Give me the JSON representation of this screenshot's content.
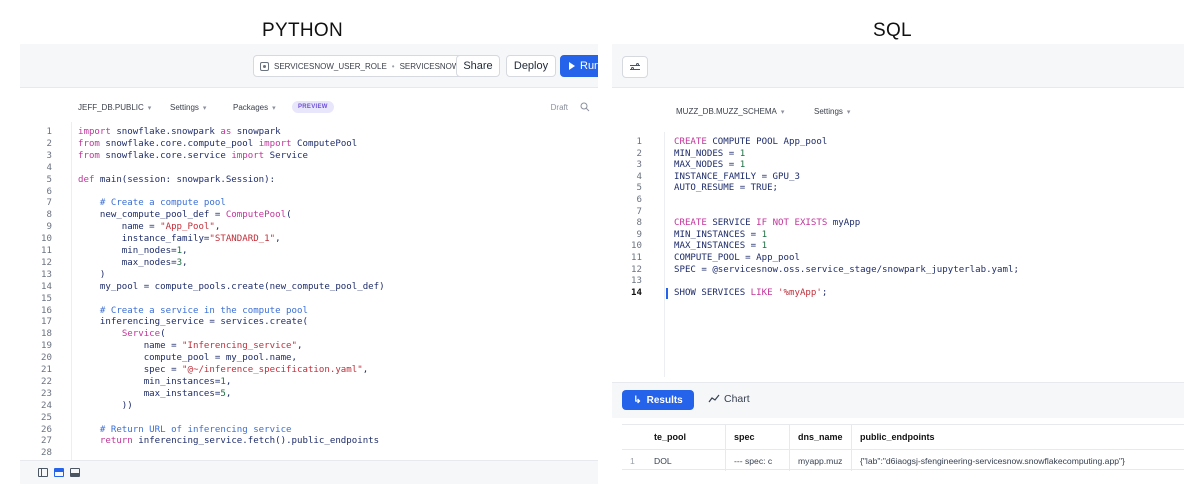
{
  "headings": {
    "python": "PYTHON",
    "sql": "SQL"
  },
  "python_panel": {
    "role_chip": {
      "role": "SERVICESNOW_USER_ROLE",
      "separator": "•",
      "warehouse": "SERVICESNOW"
    },
    "buttons": {
      "share": "Share",
      "deploy": "Deploy",
      "run": "Run"
    },
    "subbar": {
      "database": "JEFF_DB.PUBLIC",
      "settings": "Settings",
      "packages": "Packages",
      "badge": "PREVIEW",
      "status": "Draft"
    },
    "lines": [
      "1",
      "2",
      "3",
      "4",
      "5",
      "6",
      "7",
      "8",
      "9",
      "10",
      "11",
      "12",
      "13",
      "14",
      "15",
      "16",
      "17",
      "18",
      "19",
      "20",
      "21",
      "22",
      "23",
      "24",
      "25",
      "26",
      "27",
      "28"
    ],
    "code": [
      [
        [
          "kw",
          "import"
        ],
        [
          "p",
          " snowflake.snowpark "
        ],
        [
          "kw",
          "as"
        ],
        [
          "p",
          " snowpark"
        ]
      ],
      [
        [
          "kw",
          "from"
        ],
        [
          "p",
          " snowflake.core.compute_pool "
        ],
        [
          "kw",
          "import"
        ],
        [
          "p",
          " ComputePool"
        ]
      ],
      [
        [
          "kw",
          "from"
        ],
        [
          "p",
          " snowflake.core.service "
        ],
        [
          "kw",
          "import"
        ],
        [
          "p",
          " Service"
        ]
      ],
      [],
      [
        [
          "kw",
          "def"
        ],
        [
          "p",
          " main(session: snowpark.Session):"
        ]
      ],
      [],
      [
        [
          "p",
          "    "
        ],
        [
          "cmt",
          "# Create a compute pool"
        ]
      ],
      [
        [
          "p",
          "    new_compute_pool_def = "
        ],
        [
          "kw",
          "ComputePool"
        ],
        [
          "p",
          "("
        ]
      ],
      [
        [
          "p",
          "        name = "
        ],
        [
          "str",
          "\"App_Pool\""
        ],
        [
          "p",
          ","
        ]
      ],
      [
        [
          "p",
          "        instance_family="
        ],
        [
          "str",
          "\"STANDARD_1\""
        ],
        [
          "p",
          ","
        ]
      ],
      [
        [
          "p",
          "        min_nodes="
        ],
        [
          "num",
          "1"
        ],
        [
          "p",
          ","
        ]
      ],
      [
        [
          "p",
          "        max_nodes="
        ],
        [
          "num",
          "3"
        ],
        [
          "p",
          ","
        ]
      ],
      [
        [
          "p",
          "    )"
        ]
      ],
      [
        [
          "p",
          "    my_pool = compute_pools.create(new_compute_pool_def)"
        ]
      ],
      [],
      [
        [
          "p",
          "    "
        ],
        [
          "cmt",
          "# Create a service in the compute pool"
        ]
      ],
      [
        [
          "p",
          "    inferencing_service = services.create("
        ]
      ],
      [
        [
          "p",
          "        "
        ],
        [
          "kw",
          "Service"
        ],
        [
          "p",
          "("
        ]
      ],
      [
        [
          "p",
          "            name = "
        ],
        [
          "str",
          "\"Inferencing_service\""
        ],
        [
          "p",
          ","
        ]
      ],
      [
        [
          "p",
          "            compute_pool = my_pool.name,"
        ]
      ],
      [
        [
          "p",
          "            spec = "
        ],
        [
          "str",
          "\"@~/inference_specification.yaml\""
        ],
        [
          "p",
          ","
        ]
      ],
      [
        [
          "p",
          "            min_instances="
        ],
        [
          "num",
          "1"
        ],
        [
          "p",
          ","
        ]
      ],
      [
        [
          "p",
          "            max_instances="
        ],
        [
          "num",
          "5"
        ],
        [
          "p",
          ","
        ]
      ],
      [
        [
          "p",
          "        ))"
        ]
      ],
      [],
      [
        [
          "p",
          "    "
        ],
        [
          "cmt",
          "# Return URL of inferencing service"
        ]
      ],
      [
        [
          "p",
          "    "
        ],
        [
          "kw",
          "return"
        ],
        [
          "p",
          " inferencing_service.fetch().public_endpoints"
        ]
      ],
      []
    ]
  },
  "sql_panel": {
    "subbar": {
      "database": "MUZZ_DB.MUZZ_SCHEMA",
      "settings": "Settings"
    },
    "lines": [
      "1",
      "2",
      "3",
      "4",
      "5",
      "6",
      "7",
      "8",
      "9",
      "10",
      "11",
      "12",
      "13",
      "14"
    ],
    "code": [
      [
        [
          "kw",
          "CREATE"
        ],
        [
          "p",
          " COMPUTE POOL App_pool"
        ]
      ],
      [
        [
          "p",
          "MIN_NODES = "
        ],
        [
          "num",
          "1"
        ]
      ],
      [
        [
          "p",
          "MAX_NODES = "
        ],
        [
          "num",
          "1"
        ]
      ],
      [
        [
          "p",
          "INSTANCE_FAMILY = GPU_3"
        ]
      ],
      [
        [
          "p",
          "AUTO_RESUME = TRUE;"
        ]
      ],
      [],
      [],
      [
        [
          "kw",
          "CREATE"
        ],
        [
          "p",
          " SERVICE "
        ],
        [
          "kw",
          "IF NOT EXISTS"
        ],
        [
          "p",
          " myApp"
        ]
      ],
      [
        [
          "p",
          "MIN_INSTANCES = "
        ],
        [
          "num",
          "1"
        ]
      ],
      [
        [
          "p",
          "MAX_INSTANCES = "
        ],
        [
          "num",
          "1"
        ]
      ],
      [
        [
          "p",
          "COMPUTE_POOL = App_pool"
        ]
      ],
      [
        [
          "p",
          "SPEC = @servicesnow.oss.service_stage/snowpark_jupyterlab.yaml;"
        ]
      ],
      [],
      [
        [
          "p",
          "SHOW SERVICES "
        ],
        [
          "kw",
          "LIKE"
        ],
        [
          "p",
          " "
        ],
        [
          "str",
          "'%myApp'"
        ],
        [
          "p",
          ";"
        ]
      ]
    ],
    "results": {
      "results_tab": "Results",
      "chart_tab": "Chart",
      "columns": [
        "te_pool",
        "spec",
        "dns_name",
        "public_endpoints"
      ],
      "rows": [
        {
          "row_number": "1",
          "cells": [
            "DOL",
            "--- spec:  c",
            "myapp.muz",
            "{\"lab\":\"d6iaogsj-sfengineering-servicesnow.snowflakecomputing.app\"}"
          ]
        }
      ]
    }
  }
}
